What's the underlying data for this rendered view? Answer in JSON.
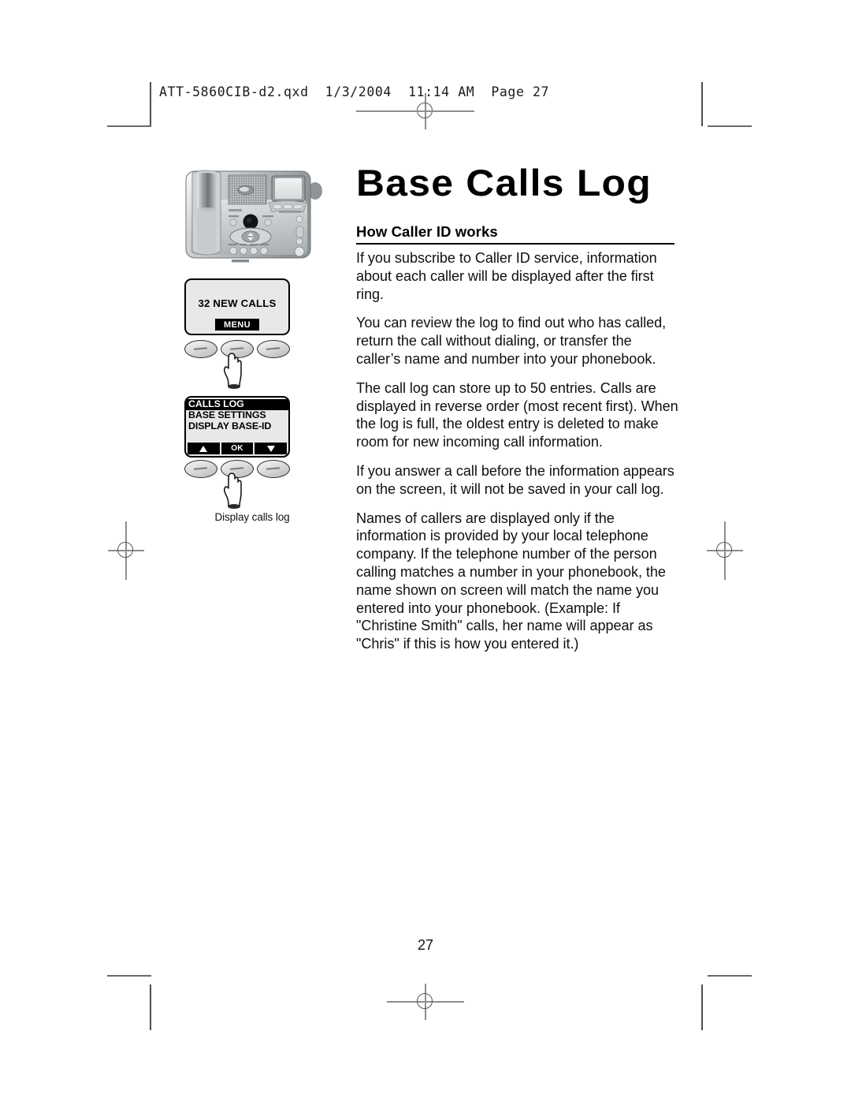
{
  "printer_slug": "ATT-5860CIB-d2.qxd  1/3/2004  11:14 AM  Page 27",
  "page": {
    "title": "Base Calls Log",
    "subhead": "How Caller ID works",
    "folio": "27"
  },
  "paragraphs": [
    "If you subscribe to Caller ID service, information about each caller will be displayed after the first ring.",
    "You can review the log to find out who has called, return the call without dialing, or transfer the caller’s name and number into your phonebook.",
    "The call log can store up to 50 entries. Calls are displayed in reverse order (most recent first). When the log is full, the oldest entry is deleted to make room for new incoming call information.",
    "If you answer a call before the information appears on the screen, it will not be saved in your call log.",
    "Names of callers are displayed only if the information is provided by your local telephone company. If the telephone number of the person calling matches a number in your phonebook, the name shown on screen will match the name you entered into your phonebook. (Example: If \"Christine Smith\" calls, her name will appear as \"Chris\" if this is how you entered it.)"
  ],
  "illustration": {
    "caption": "Display calls log",
    "screen_one": {
      "message": "32 NEW CALLS",
      "softkey": "MENU"
    },
    "screen_two": {
      "menu_items": [
        {
          "label": "CALLS LOG",
          "selected": true
        },
        {
          "label": "BASE SETTINGS",
          "selected": false
        },
        {
          "label": "DISPLAY BASE-ID",
          "selected": false
        }
      ],
      "softkeys": [
        "up-arrow",
        "OK",
        "down-arrow"
      ]
    }
  }
}
